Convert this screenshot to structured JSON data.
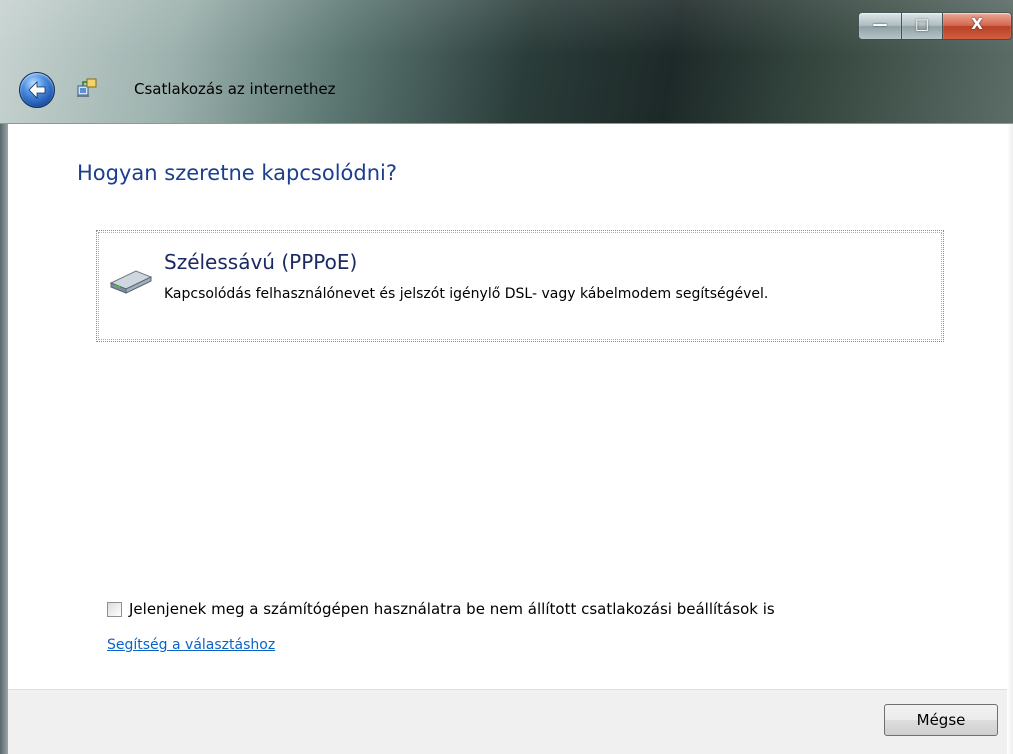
{
  "window": {
    "title": "Csatlakozás az internethez",
    "caption_buttons": {
      "minimize_glyph": "—",
      "maximize_glyph": "□",
      "close_glyph": "X"
    }
  },
  "main": {
    "heading": "Hogyan szeretne kapcsolódni?",
    "option": {
      "title": "Szélessávú (PPPoE)",
      "description": "Kapcsolódás felhasználónevet és jelszót igénylő DSL- vagy kábelmodem segítségével.",
      "icon": "modem-icon"
    },
    "checkbox": {
      "label": "Jelenjenek meg a számítógépen használatra be nem állított csatlakozási beállítások is",
      "checked": false
    },
    "help_link": "Segítség a választáshoz"
  },
  "footer": {
    "cancel_label": "Mégse"
  },
  "colors": {
    "heading": "#1a3f8f",
    "link": "#0a64c8",
    "footer_bg": "#f0f0f0"
  }
}
